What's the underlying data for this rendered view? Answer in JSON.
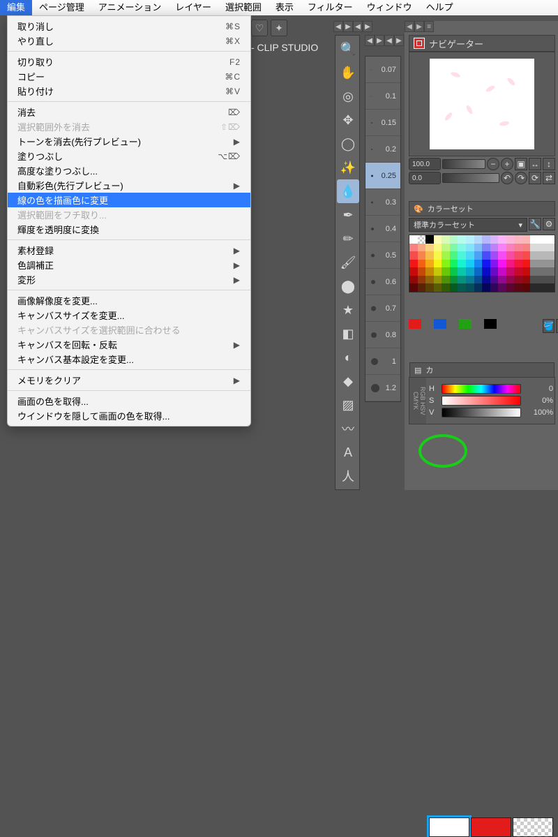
{
  "menubar": {
    "items": [
      "編集",
      "ページ管理",
      "アニメーション",
      "レイヤー",
      "選択範囲",
      "表示",
      "フィルター",
      "ウィンドウ",
      "ヘルプ"
    ]
  },
  "dropdown": {
    "undo": "取り消し",
    "undo_sc": "⌘S",
    "redo": "やり直し",
    "redo_sc": "⌘X",
    "cut": "切り取り",
    "cut_sc": "F2",
    "copy": "コピー",
    "copy_sc": "⌘C",
    "paste": "貼り付け",
    "paste_sc": "⌘V",
    "clear": "消去",
    "clear_sc": "⌦",
    "clear_outside": "選択範囲外を消去",
    "clear_outside_sc": "⇧⌦",
    "clear_tone": "トーンを消去(先行プレビュー)",
    "fill": "塗りつぶし",
    "fill_sc": "⌥⌦",
    "adv_fill": "高度な塗りつぶし...",
    "auto_color": "自動彩色(先行プレビュー)",
    "line_to_draw": "線の色を描画色に変更",
    "outline_sel": "選択範囲をフチ取り...",
    "lum_to_alpha": "輝度を透明度に変換",
    "register_mat": "素材登録",
    "tonal": "色調補正",
    "transform": "変形",
    "change_res": "画像解像度を変更...",
    "change_canvas": "キャンバスサイズを変更...",
    "canvas_to_sel": "キャンバスサイズを選択範囲に合わせる",
    "rotate_canvas": "キャンバスを回転・反転",
    "canvas_props": "キャンバス基本設定を変更...",
    "clear_mem": "メモリをクリア",
    "get_color": "画面の色を取得...",
    "get_color_hide": "ウインドウを隠して画面の色を取得..."
  },
  "doc": {
    "title": "- CLIP STUDIO"
  },
  "sizes": [
    "0.07",
    "0.1",
    "0.15",
    "0.2",
    "0.25",
    "0.3",
    "0.4",
    "0.5",
    "0.6",
    "0.7",
    "0.8",
    "1",
    "1.2"
  ],
  "navigator": {
    "title": "ナビゲーター",
    "zoom": "100.0",
    "angle": "0.0"
  },
  "colorset": {
    "title": "カラーセット",
    "dropdown": "標準カラーセット"
  },
  "hsv": {
    "panel_title": "カ",
    "h_label": "H",
    "h_val": "0",
    "s_label": "S",
    "s_val": "0%",
    "v_label": "V",
    "v_val": "100%"
  },
  "recent_colors": [
    "#e21b1b",
    "#1158d6",
    "#23a014",
    "#000000"
  ]
}
